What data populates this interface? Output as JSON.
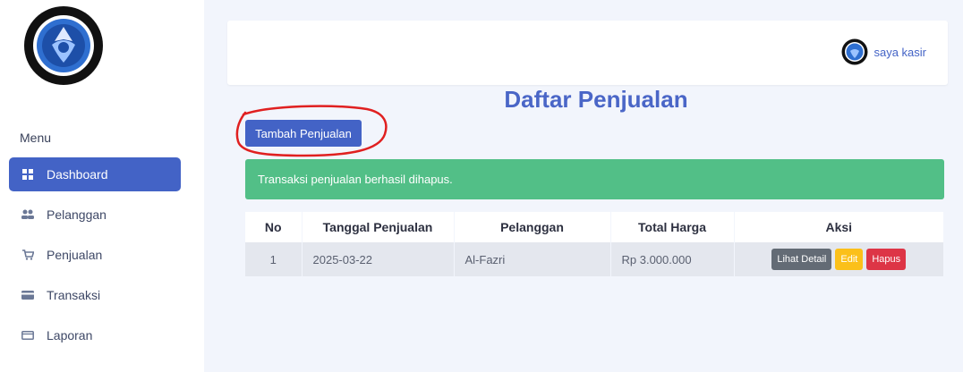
{
  "sidebar": {
    "menu_title": "Menu",
    "items": [
      {
        "label": "Dashboard",
        "icon": "grid-icon",
        "active": true
      },
      {
        "label": "Pelanggan",
        "icon": "users-icon",
        "active": false
      },
      {
        "label": "Penjualan",
        "icon": "cart-icon",
        "active": false
      },
      {
        "label": "Transaksi",
        "icon": "credit-card-icon",
        "active": false
      },
      {
        "label": "Laporan",
        "icon": "document-icon",
        "active": false
      }
    ]
  },
  "header": {
    "user_name": "saya kasir",
    "user_icon": "logo-icon"
  },
  "main": {
    "title": "Daftar Penjualan",
    "add_button": "Tambah Penjualan",
    "alert": "Transaksi penjualan berhasil dihapus.",
    "table": {
      "columns": [
        "No",
        "Tanggal Penjualan",
        "Pelanggan",
        "Total Harga",
        "Aksi"
      ],
      "rows": [
        {
          "no": "1",
          "date": "2025-03-22",
          "customer": "Al-Fazri",
          "total": "Rp 3.000.000",
          "actions": [
            "Lihat Detail",
            "Edit",
            "Hapus"
          ]
        }
      ]
    }
  },
  "colors": {
    "primary": "#4363c6",
    "success": "#52bf87",
    "warning": "#fbc01a",
    "danger": "#dd3546",
    "secondary": "#636b75",
    "annotation": "#e02020"
  }
}
